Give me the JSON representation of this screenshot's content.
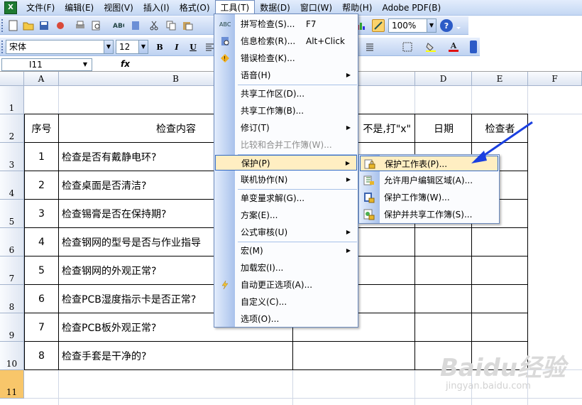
{
  "menubar": {
    "items": [
      "文件(F)",
      "编辑(E)",
      "视图(V)",
      "插入(I)",
      "格式(O)",
      "工具(T)",
      "数据(D)",
      "窗口(W)",
      "帮助(H)",
      "Adobe PDF(B)"
    ]
  },
  "toolbar": {
    "zoom": "100%",
    "font_name": "宋体",
    "font_size": "12",
    "bold_label": "B",
    "italic_label": "I",
    "underline_label": "U",
    "font_color_label": "A"
  },
  "formula_bar": {
    "name_box": "I11",
    "fx_label": "fx"
  },
  "sheet": {
    "columns": [
      "A",
      "B",
      "C",
      "D",
      "E",
      "F"
    ],
    "rows": [
      "1",
      "2",
      "3",
      "4",
      "5",
      "6",
      "7",
      "8",
      "9",
      "10",
      "11"
    ],
    "header": {
      "seq": "序号",
      "content": "检查内容",
      "result": "不是,打\"x\"",
      "date": "日期",
      "checker": "检查者"
    },
    "data_rows": [
      {
        "seq": "1",
        "content": "检查是否有戴静电环?"
      },
      {
        "seq": "2",
        "content": "检查桌面是否清洁?"
      },
      {
        "seq": "3",
        "content": "检查锡膏是否在保持期?"
      },
      {
        "seq": "4",
        "content": "检查钢网的型号是否与作业指导"
      },
      {
        "seq": "5",
        "content": "检查钢网的外观正常?"
      },
      {
        "seq": "6",
        "content": "检查PCB湿度指示卡是否正常?"
      },
      {
        "seq": "7",
        "content": "检查PCB板外观正常?"
      },
      {
        "seq": "8",
        "content": "检查手套是干净的?"
      }
    ]
  },
  "tools_menu": {
    "spelling": "拼写检查(S)...",
    "spelling_shortcut": "F7",
    "research": "信息检索(R)...",
    "research_shortcut": "Alt+Click",
    "error_check": "错误检查(K)...",
    "speech": "语音(H)",
    "share_workspace": "共享工作区(D)...",
    "share_workbook": "共享工作簿(B)...",
    "track_changes": "修订(T)",
    "compare_merge": "比较和合并工作簿(W)...",
    "protection": "保护(P)",
    "online_collab": "联机协作(N)",
    "goal_seek": "单变量求解(G)...",
    "scenarios": "方案(E)...",
    "formula_audit": "公式审核(U)",
    "macro": "宏(M)",
    "addins": "加载宏(I)...",
    "autocorrect": "自动更正选项(A)...",
    "customize": "自定义(C)...",
    "options": "选项(O)..."
  },
  "protection_submenu": {
    "protect_sheet": "保护工作表(P)...",
    "allow_edit_ranges": "允许用户编辑区域(A)...",
    "protect_workbook": "保护工作簿(W)...",
    "protect_share": "保护并共享工作簿(S)..."
  },
  "watermark": {
    "text": "Baidu经验",
    "url": "jingyan.baidu.com"
  },
  "colors": {
    "highlight": "#ffeec2",
    "menu_border": "#316ac5",
    "arrow": "#1a3fe0",
    "selected_row": "#f8c66a"
  }
}
